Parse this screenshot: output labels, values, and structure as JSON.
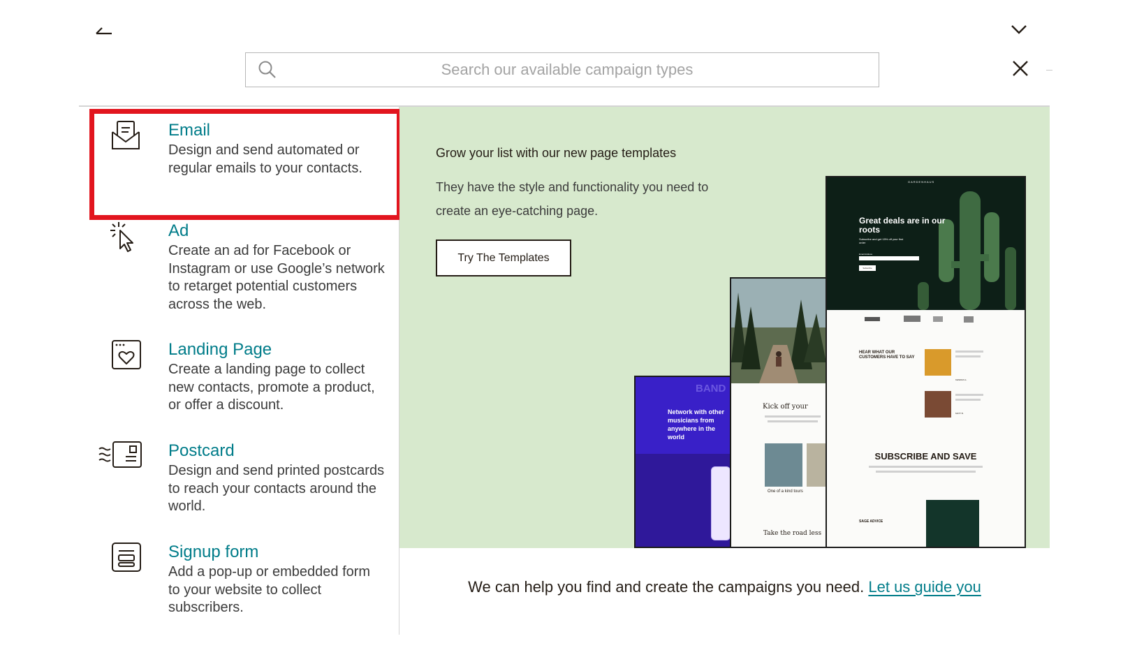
{
  "search": {
    "placeholder": "Search our available campaign types"
  },
  "campaign_types": [
    {
      "title": "Email",
      "description": "Design and send automated or regular emails to your contacts.",
      "icon": "envelope-icon",
      "highlighted": true
    },
    {
      "title": "Ad",
      "description": "Create an ad for Facebook or Instagram or use Google’s network to retarget potential customers across the web.",
      "icon": "cursor-click-icon"
    },
    {
      "title": "Landing Page",
      "description": "Create a landing page to collect new contacts, promote a product, or offer a discount.",
      "icon": "heart-page-icon"
    },
    {
      "title": "Postcard",
      "description": "Design and send printed postcards to reach your contacts around the world.",
      "icon": "postcard-icon"
    },
    {
      "title": "Signup form",
      "description": "Add a pop-up or embedded form to your website to collect subscribers.",
      "icon": "form-icon"
    }
  ],
  "promo": {
    "title": "Grow your list with our new page templates",
    "text": "They have the style and functionality you need to create an eye-catching page.",
    "button_label": "Try The Templates",
    "mockups": {
      "left": {
        "brand": "BAND",
        "headline": "Network with other musicians from anywhere in the world"
      },
      "middle": {
        "heading": "Kick off your",
        "caption": "One of a kind tours",
        "footer": "Take the road less"
      },
      "right": {
        "brand": "GARDENHAUS",
        "headline": "Great deals are in our roots",
        "subtext": "Subscribe and get 15% off your first order",
        "field_label": "Email Address",
        "button": "Subscribe",
        "testimonials_heading": "HEAR WHAT OUR CUSTOMERS HAVE TO SAY",
        "testimonial_author": "KENDRA G.",
        "testimonial_author_2": "MATT B.",
        "subscribe_heading": "SUBSCRIBE AND SAVE",
        "advice_heading": "SAGE ADVICE"
      }
    }
  },
  "footer": {
    "text": "We can help you find and create the campaigns you need.",
    "link_label": "Let us guide you"
  },
  "colors": {
    "accent": "#007c89",
    "highlight": "#e2151e",
    "promo_background": "#d7e9cd",
    "text": "#241c15"
  }
}
